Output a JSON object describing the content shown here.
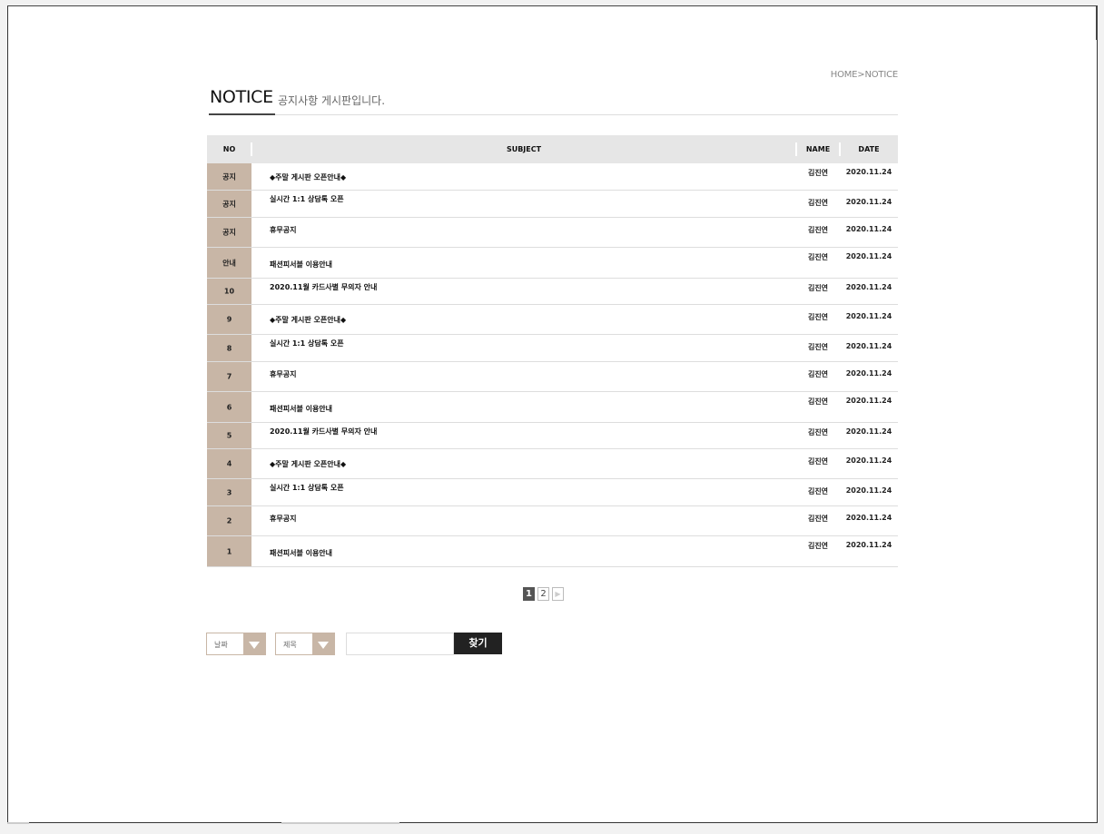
{
  "breadcrumb": "HOME>NOTICE",
  "page": {
    "title": "NOTICE",
    "subtitle": "공지사항 게시판입니다."
  },
  "table": {
    "headers": {
      "no": "NO",
      "subject": "SUBJECT",
      "name": "NAME",
      "date": "DATE"
    },
    "rows": [
      {
        "no": "공지",
        "subject": "◆주말 게시판 오픈안내◆",
        "name": "김진연",
        "date": "2020.11.24"
      },
      {
        "no": "공지",
        "subject": "실시간 1:1 상담톡 오픈",
        "name": "김진연",
        "date": "2020.11.24"
      },
      {
        "no": "공지",
        "subject": "휴무공지",
        "name": "김진연",
        "date": "2020.11.24"
      },
      {
        "no": "안내",
        "subject": "패션피서블 이용안내",
        "name": "김진연",
        "date": "2020.11.24"
      },
      {
        "no": "10",
        "subject": "2020.11월 카드사별 무의자 안내",
        "name": "김진연",
        "date": "2020.11.24"
      },
      {
        "no": "9",
        "subject": "◆주말 게시판 오픈안내◆",
        "name": "김진연",
        "date": "2020.11.24"
      },
      {
        "no": "8",
        "subject": "실시간 1:1 상담톡 오픈",
        "name": "김진연",
        "date": "2020.11.24"
      },
      {
        "no": "7",
        "subject": "휴무공지",
        "name": "김진연",
        "date": "2020.11.24"
      },
      {
        "no": "6",
        "subject": "패션피서블 이용안내",
        "name": "김진연",
        "date": "2020.11.24"
      },
      {
        "no": "5",
        "subject": "2020.11월 카드사별 무의자 안내",
        "name": "김진연",
        "date": "2020.11.24"
      },
      {
        "no": "4",
        "subject": "◆주말 게시판 오픈안내◆",
        "name": "김진연",
        "date": "2020.11.24"
      },
      {
        "no": "3",
        "subject": "실시간 1:1 상담톡 오픈",
        "name": "김진연",
        "date": "2020.11.24"
      },
      {
        "no": "2",
        "subject": "휴무공지",
        "name": "김진연",
        "date": "2020.11.24"
      },
      {
        "no": "1",
        "subject": "패션피서블 이용안내",
        "name": "김진연",
        "date": "2020.11.24"
      }
    ]
  },
  "pagination": {
    "pages": [
      "1",
      "2"
    ],
    "current": "1",
    "next_icon": "play-icon"
  },
  "search": {
    "filter1": "날짜",
    "filter2": "제목",
    "input_value": "",
    "button_label": "찾기"
  },
  "colors": {
    "accent": "#c8b6a6",
    "button": "#222222",
    "header_bg": "#e6e6e6"
  }
}
